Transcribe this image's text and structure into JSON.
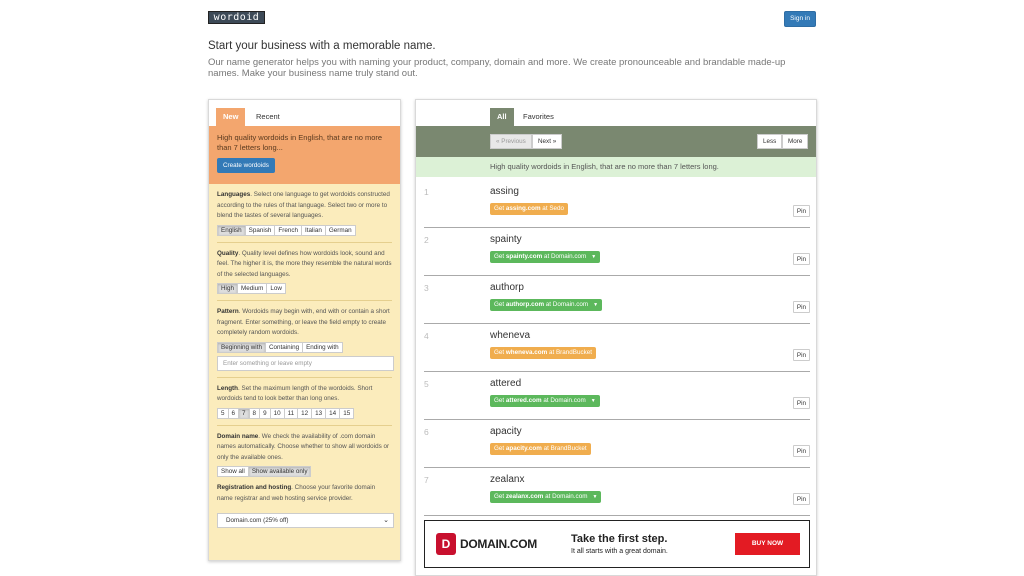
{
  "header": {
    "logo_text": "wordoid",
    "signin_label": "Sign in"
  },
  "intro": {
    "headline": "Start your business with a memorable name.",
    "description": "Our name generator helps you with naming your product, company, domain and more. We create pronounceable and brandable made-up names. Make your business name truly stand out."
  },
  "left": {
    "tabs": [
      "New",
      "Recent"
    ],
    "hero_text": "High quality wordoids in English, that are no more than 7 letters long...",
    "create_label": "Create wordoids",
    "languages": {
      "title": "Languages",
      "desc": ". Select one language to get wordoids constructed according to the rules of that language. Select two or more to blend the tastes of several languages.",
      "options": [
        "English",
        "Spanish",
        "French",
        "Italian",
        "German"
      ],
      "selected": "English"
    },
    "quality": {
      "title": "Quality",
      "desc": ". Quality level defines how wordoids look, sound and feel. The higher it is, the more they resemble the natural words of the selected languages.",
      "options": [
        "High",
        "Medium",
        "Low"
      ],
      "selected": "High"
    },
    "pattern": {
      "title": "Pattern",
      "desc": ". Wordoids may begin with, end with or contain a short fragment. Enter something, or leave the field empty to create completely random wordoids.",
      "options": [
        "Beginning with",
        "Containing",
        "Ending with"
      ],
      "selected": "Beginning with",
      "placeholder": "Enter something or leave empty"
    },
    "length": {
      "title": "Length",
      "desc": ". Set the maximum length of the wordoids. Short wordoids tend to look better than long ones.",
      "options": [
        "5",
        "6",
        "7",
        "8",
        "9",
        "10",
        "11",
        "12",
        "13",
        "14",
        "15"
      ],
      "selected": "7"
    },
    "domain": {
      "title": "Domain name",
      "desc": ". We check the availability of .com domain names automatically. Choose whether to show all wordoids or only the available ones.",
      "options": [
        "Show all",
        "Show available only"
      ],
      "selected": "Show available only"
    },
    "registration": {
      "title": "Registration and hosting",
      "desc": ". Choose your favorite domain name registrar and web hosting service provider.",
      "value": "Domain.com (25% off)"
    }
  },
  "right": {
    "tabs": [
      "All",
      "Favorites"
    ],
    "prev_label": "« Previous",
    "next_label": "Next »",
    "less_label": "Less",
    "more_label": "More",
    "info": "High quality wordoids in English, that are no more than 7 letters long.",
    "results": [
      {
        "num": "1",
        "word": "assing",
        "prefix": "Get ",
        "domain": "assing.com",
        "suffix": " at Sedo",
        "color": "#f0ad4e",
        "dropdown": false
      },
      {
        "num": "2",
        "word": "spainty",
        "prefix": "Get ",
        "domain": "spainty.com",
        "suffix": " at Domain.com",
        "color": "#5cb85c",
        "dropdown": true
      },
      {
        "num": "3",
        "word": "authorp",
        "prefix": "Get ",
        "domain": "authorp.com",
        "suffix": " at Domain.com",
        "color": "#5cb85c",
        "dropdown": true
      },
      {
        "num": "4",
        "word": "wheneva",
        "prefix": "Get ",
        "domain": "wheneva.com",
        "suffix": " at BrandBucket",
        "color": "#f0ad4e",
        "dropdown": false
      },
      {
        "num": "5",
        "word": "attered",
        "prefix": "Get ",
        "domain": "attered.com",
        "suffix": " at Domain.com",
        "color": "#5cb85c",
        "dropdown": true
      },
      {
        "num": "6",
        "word": "apacity",
        "prefix": "Get ",
        "domain": "apacity.com",
        "suffix": " at BrandBucket",
        "color": "#f0ad4e",
        "dropdown": false
      },
      {
        "num": "7",
        "word": "zealanx",
        "prefix": "Get ",
        "domain": "zealanx.com",
        "suffix": " at Domain.com",
        "color": "#5cb85c",
        "dropdown": true
      }
    ],
    "pin_label": "Pin",
    "ad": {
      "logo_glyph": "D",
      "brand": "DOMAIN.COM",
      "title": "Take the first step.",
      "subtitle": "It all starts with a great domain.",
      "button": "BUY NOW"
    }
  }
}
